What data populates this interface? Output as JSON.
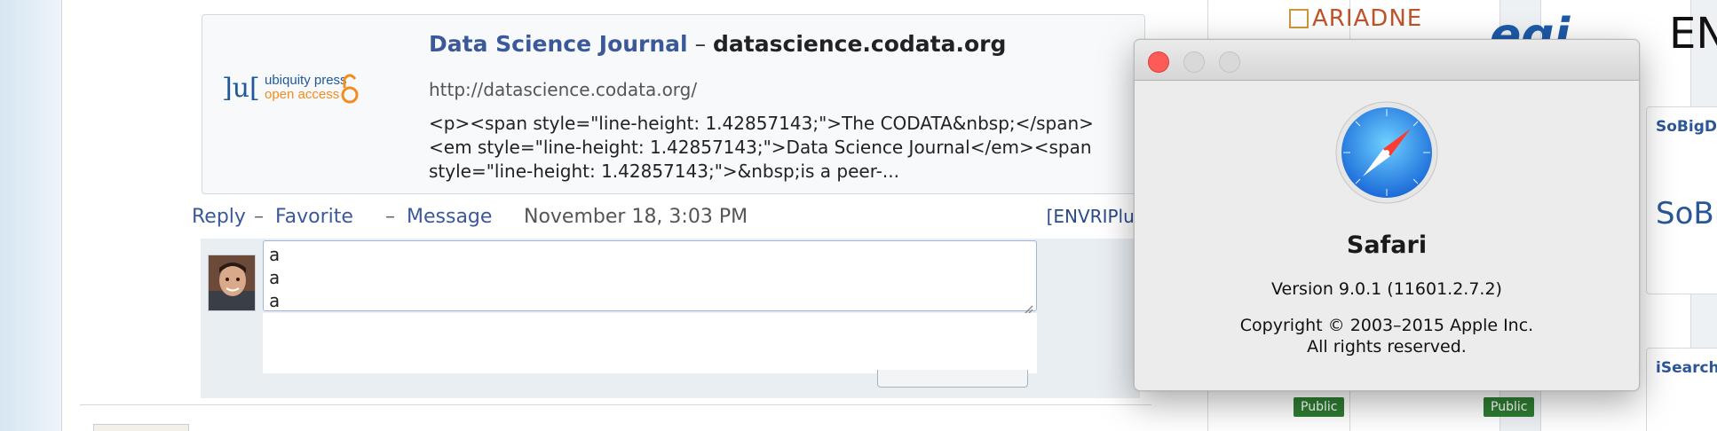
{
  "feed": {
    "preview": {
      "logo_text": "ubiquity press",
      "logo_sub": "open access",
      "title": "Data Science Journal",
      "title_sep": " – ",
      "domain": "datascience.codata.org",
      "url": "http://datascience.codata.org/",
      "description": "<p><span style=\"line-height: 1.42857143;\">The CODATA&nbsp;</span><em style=\"line-height: 1.42857143;\">Data Science Journal</em><span style=\"line-height: 1.42857143;\">&nbsp;is a peer-..."
    },
    "actions": {
      "reply": "Reply",
      "favorite": "Favorite",
      "message": "Message",
      "separator": "–",
      "timestamp": "November 18, 3:03 PM",
      "group_tag": "[ENVRIPlus]"
    },
    "comment": {
      "lines": [
        "a",
        "a",
        "a"
      ]
    }
  },
  "sidebar": {
    "ariadne_logo": "ARIADNE",
    "egi_logo": "egi",
    "en_logo": "EN",
    "sobigdata_title": "SoBigDa",
    "sobigdata_logo": "SoBi",
    "isearch_title": "iSearch",
    "public_badge_1": "Public",
    "public_badge_2": "Public"
  },
  "dialog": {
    "app_name": "Safari",
    "version": "Version 9.0.1 (11601.2.7.2)",
    "copyright_line1": "Copyright © 2003–2015 Apple Inc.",
    "copyright_line2": "All rights reserved.",
    "colors": {
      "close": "#fc5b57",
      "inactive": "#d9d9d9"
    }
  }
}
